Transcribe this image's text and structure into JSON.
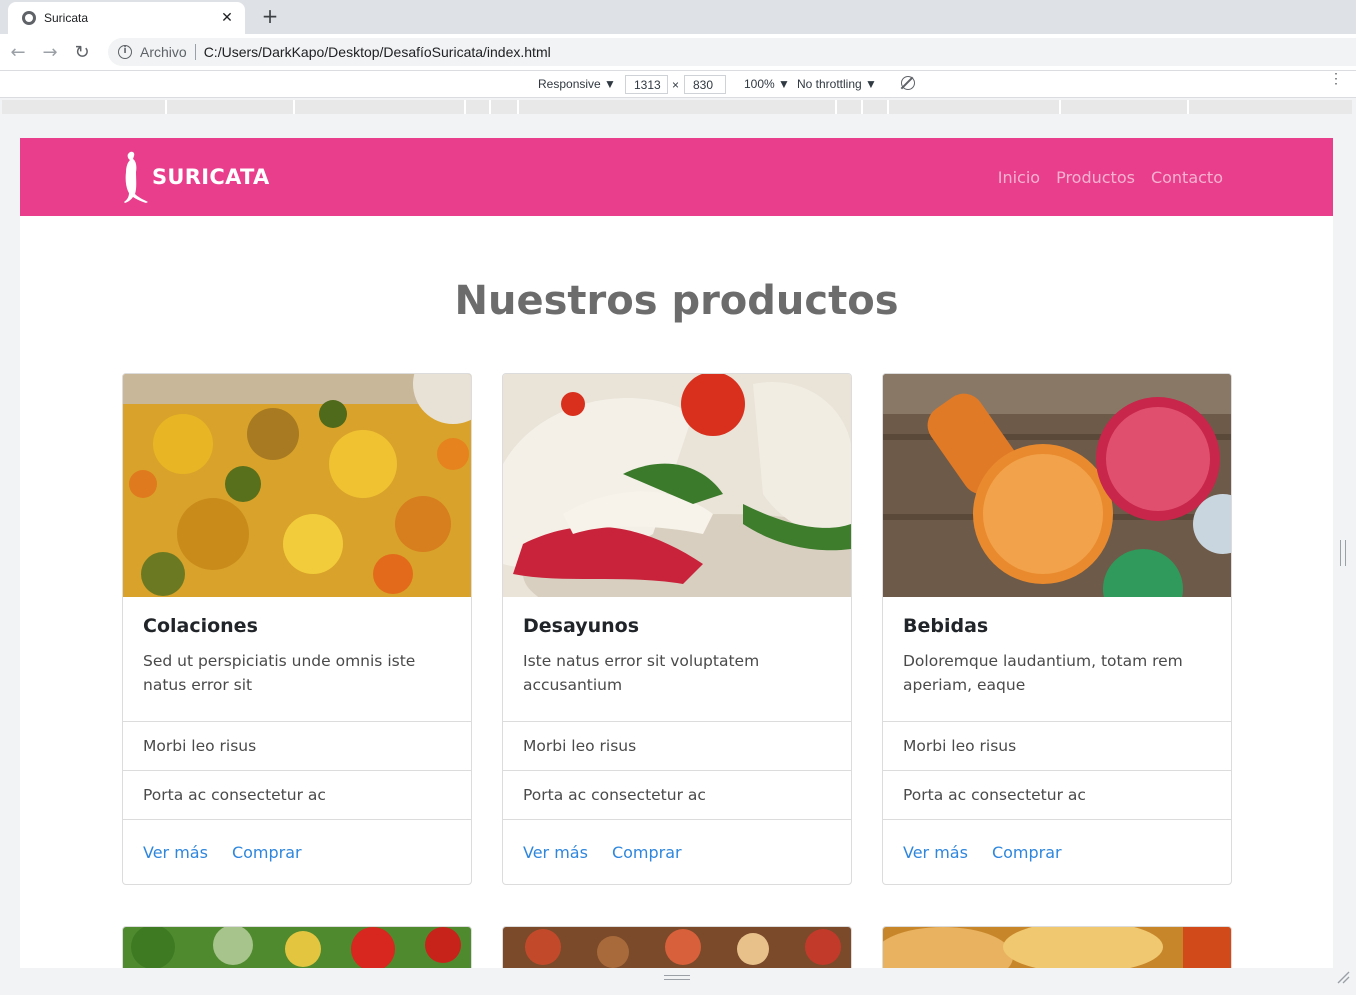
{
  "browser": {
    "tab_title": "Suricata",
    "tab_close": "✕",
    "new_tab": "+",
    "scheme_label": "Archivo",
    "url": "C:/Users/DarkKapo/Desktop/DesafíoSuricata/index.html"
  },
  "devtools": {
    "device": "Responsive ▼",
    "width": "1313",
    "times": "×",
    "height": "830",
    "zoom": "100% ▼",
    "throttling": "No throttling ▼"
  },
  "site": {
    "brand": "SURICATA",
    "nav": [
      "Inicio",
      "Productos",
      "Contacto"
    ],
    "heading": "Nuestros productos",
    "brand_color": "#e83e8c",
    "link_color": "#2e86de",
    "cards": [
      {
        "image": "mixed-vegetable-dish-image",
        "title": "Colaciones",
        "text": "Sed ut perspiciatis unde omnis iste natus error sit",
        "items": [
          "Morbi leo risus",
          "Porta ac consectetur ac"
        ],
        "links": [
          "Ver más",
          "Comprar"
        ]
      },
      {
        "image": "sandwich-image",
        "title": "Desayunos",
        "text": "Iste natus error sit voluptatem accusantium",
        "items": [
          "Morbi leo risus",
          "Porta ac consectetur ac"
        ],
        "links": [
          "Ver más",
          "Comprar"
        ]
      },
      {
        "image": "drinks-image",
        "title": "Bebidas",
        "text": "Doloremque laudantium, totam rem aperiam, eaque",
        "items": [
          "Morbi leo risus",
          "Porta ac consectetur ac"
        ],
        "links": [
          "Ver más",
          "Comprar"
        ]
      }
    ],
    "partial_cards": [
      "vegetables-image",
      "market-image",
      "bread-image"
    ]
  }
}
